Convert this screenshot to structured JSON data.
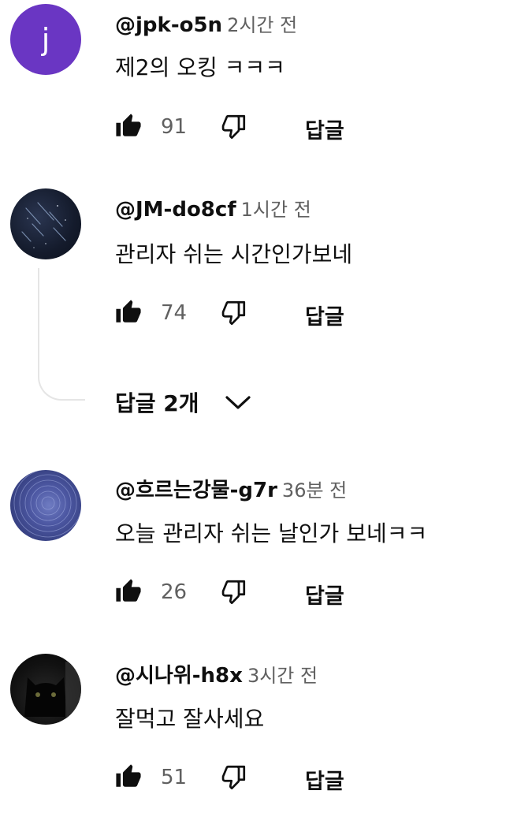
{
  "comments": [
    {
      "author": "@jpk-o5n",
      "time": "2시간 전",
      "text": "제2의 오킹 ㅋㅋㅋ",
      "likes": "91",
      "reply_label": "답글",
      "avatar": {
        "type": "letter",
        "letter": "j",
        "color": "#6a36c3"
      }
    },
    {
      "author": "@JM-do8cf",
      "time": "1시간 전",
      "text": "관리자 쉬는 시간인가보네",
      "likes": "74",
      "reply_label": "답글",
      "avatar": {
        "type": "image",
        "icon": "starry-night-avatar"
      }
    },
    {
      "author": "@흐르는강물-g7r",
      "time": "36분 전",
      "text": "오늘 관리자 쉬는 날인가 보네ㅋㅋ",
      "likes": "26",
      "reply_label": "답글",
      "avatar": {
        "type": "image",
        "icon": "swirl-avatar"
      }
    },
    {
      "author": "@시나위-h8x",
      "time": "3시간 전",
      "text": "잘먹고 잘사세요",
      "likes": "51",
      "reply_label": "답글",
      "avatar": {
        "type": "image",
        "icon": "black-cat-avatar"
      }
    }
  ],
  "replies_toggle": {
    "label": "답글 2개",
    "icon": "chevron-down-icon"
  },
  "icons": {
    "like": "thumbs-up-icon",
    "dislike": "thumbs-down-icon"
  }
}
